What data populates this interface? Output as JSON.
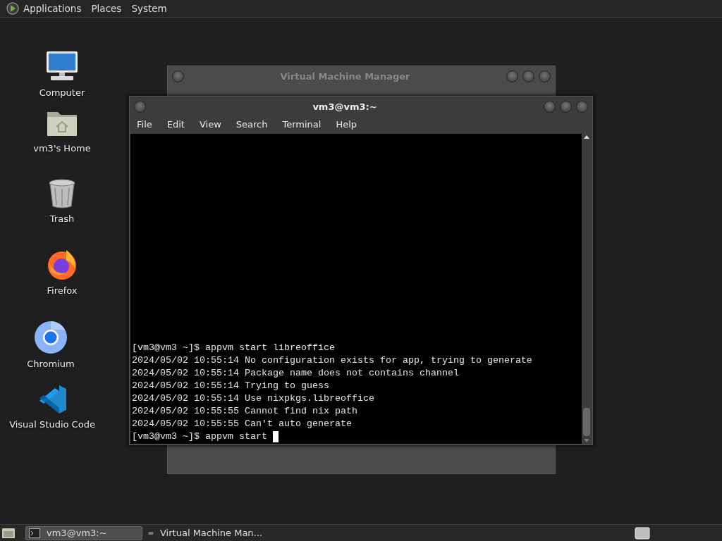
{
  "top_panel": {
    "menus": [
      "Applications",
      "Places",
      "System"
    ]
  },
  "desktop_icons": [
    {
      "label": "Computer"
    },
    {
      "label": "vm3's Home"
    },
    {
      "label": "Trash"
    },
    {
      "label": "Firefox"
    },
    {
      "label": "Chromium"
    },
    {
      "label": "Visual Studio Code"
    }
  ],
  "background_window": {
    "title": "Virtual Machine Manager"
  },
  "terminal_window": {
    "title": "vm3@vm3:~",
    "menu": [
      "File",
      "Edit",
      "View",
      "Search",
      "Terminal",
      "Help"
    ],
    "lines": [
      "[vm3@vm3 ~]$ appvm start libreoffice",
      "2024/05/02 10:55:14 No configuration exists for app, trying to generate",
      "2024/05/02 10:55:14 Package name does not contains channel",
      "2024/05/02 10:55:14 Trying to guess",
      "2024/05/02 10:55:14 Use nixpkgs.libreoffice",
      "2024/05/02 10:55:55 Cannot find nix path",
      "2024/05/02 10:55:55 Can't auto generate"
    ],
    "prompt": "[vm3@vm3 ~]$ appvm start"
  },
  "taskbar": {
    "items": [
      {
        "label": "vm3@vm3:~",
        "selected": true
      },
      {
        "label": "Virtual Machine Man...",
        "selected": false
      }
    ]
  }
}
